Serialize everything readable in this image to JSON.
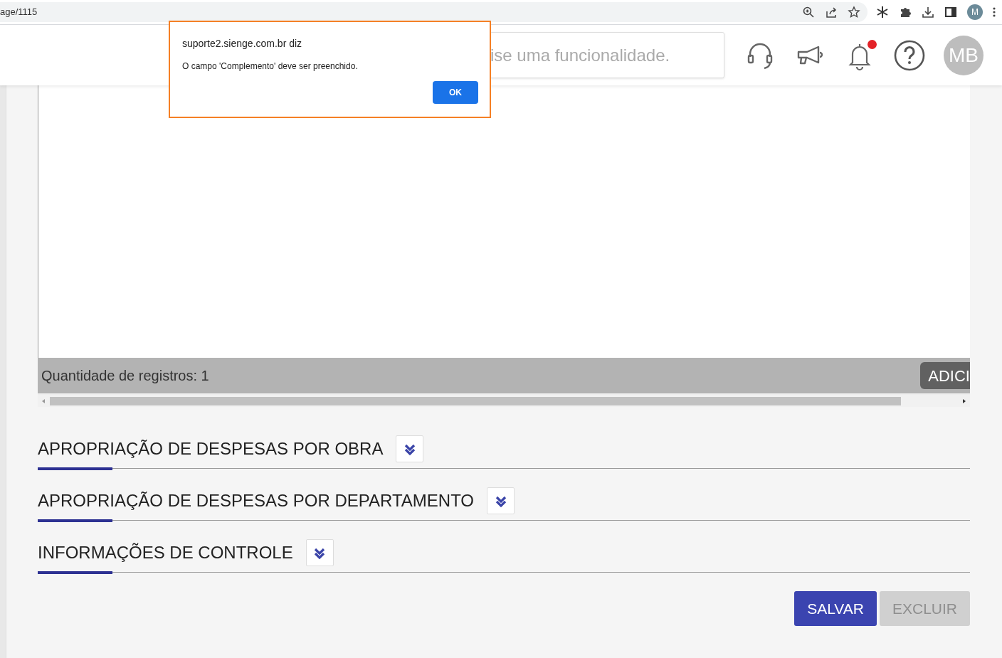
{
  "browser": {
    "url": "age/1115",
    "profile_initial": "M"
  },
  "header": {
    "search": {
      "placeholder": "ise uma funcionalidade."
    },
    "notification_dot": true,
    "avatar": "MB"
  },
  "table_footer": {
    "label": "Quantidade de registros:",
    "count": "1",
    "add_button": "ADICI"
  },
  "sections": [
    {
      "title": "APROPRIAÇÃO DE DESPESAS POR OBRA",
      "expanded": false
    },
    {
      "title": "APROPRIAÇÃO DE DESPESAS POR DEPARTAMENTO",
      "expanded": false
    },
    {
      "title": "INFORMAÇÕES DE CONTROLE",
      "expanded": false
    }
  ],
  "buttons": [
    {
      "label": "SALVAR",
      "disabled": false
    },
    {
      "label": "EXCLUIR",
      "disabled": true
    }
  ],
  "dialog": {
    "title": "suporte2.sienge.com.br diz",
    "message": "O campo 'Complemento' deve ser preenchido.",
    "ok": "OK"
  }
}
